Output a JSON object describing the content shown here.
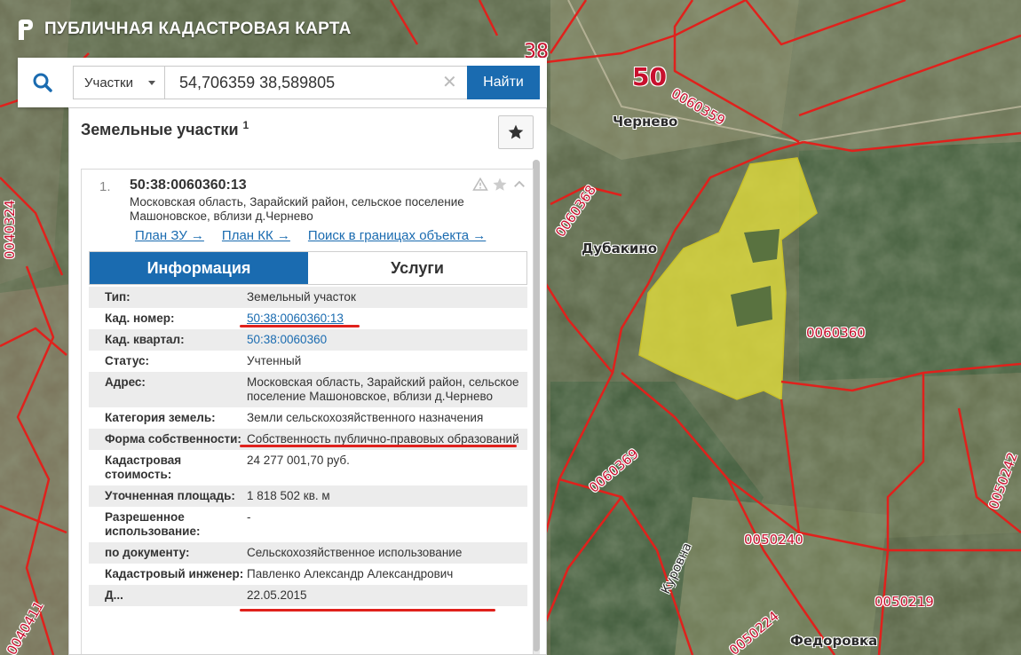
{
  "app": {
    "title": "ПУБЛИЧНАЯ КАДАСТРОВАЯ КАРТА"
  },
  "search": {
    "type_label": "Участки",
    "query": "54,706359 38,589805",
    "find_label": "Найти"
  },
  "panel": {
    "title": "Земельные участки",
    "count": "1"
  },
  "result": {
    "index": "1.",
    "cad_number": "50:38:0060360:13",
    "address": "Московская область, Зарайский район, сельское поселение Машоновское, вблизи д.Чернево",
    "links": [
      {
        "label": "План ЗУ →"
      },
      {
        "label": "План КК →"
      },
      {
        "label": "Поиск в границах объекта →"
      }
    ],
    "tabs": [
      {
        "label": "Информация",
        "active": true
      },
      {
        "label": "Услуги",
        "active": false
      }
    ],
    "info": [
      {
        "label": "Тип:",
        "value": "Земельный участок"
      },
      {
        "label": "Кад. номер:",
        "value": "50:38:0060360:13"
      },
      {
        "label": "Кад. квартал:",
        "value": "50:38:0060360"
      },
      {
        "label": "Статус:",
        "value": "Учтенный"
      },
      {
        "label": "Адрес:",
        "value": "Московская область, Зарайский район, сельское поселение Машоновское, вблизи д.Чернево"
      },
      {
        "label": "Категория земель:",
        "value": "Земли сельскохозяйственного назначения"
      },
      {
        "label": "Форма собственности:",
        "value": "Собственность публично-правовых образований"
      },
      {
        "label": "Кадастровая стоимость:",
        "value": "24 277 001,70 руб."
      },
      {
        "label": "Уточненная площадь:",
        "value": "1 818 502 кв. м"
      },
      {
        "label": "Разрешенное использование:",
        "value": "-"
      },
      {
        "label": "по документу:",
        "value": "Сельскохозяйственное использование"
      },
      {
        "label": "Кадастровый инженер:",
        "value": "Павленко Александр Александрович"
      },
      {
        "label": "Д...",
        "value": "22.05.2015"
      }
    ]
  },
  "map": {
    "labels": {
      "region": "50",
      "parcel_0060359": "0060359",
      "parcel_38": "38",
      "parcel_0060368": "0060368",
      "parcel_0060360": "0060360",
      "parcel_0060369": "0060369",
      "parcel_0050240": "0050240",
      "parcel_0050219": "0050219",
      "parcel_0050224": "0050224",
      "parcel_0050242": "0050242",
      "parcel_0040324": "0040324",
      "parcel_0040411": "0040411",
      "village_chernevo": "Чернево",
      "village_dubakino": "Дубакино",
      "village_fedorovka": "Федоровка",
      "river_kurovna": "Куровна"
    },
    "colors": {
      "boundary": "#e0211c",
      "selected_parcel": "#e8e33a"
    }
  }
}
